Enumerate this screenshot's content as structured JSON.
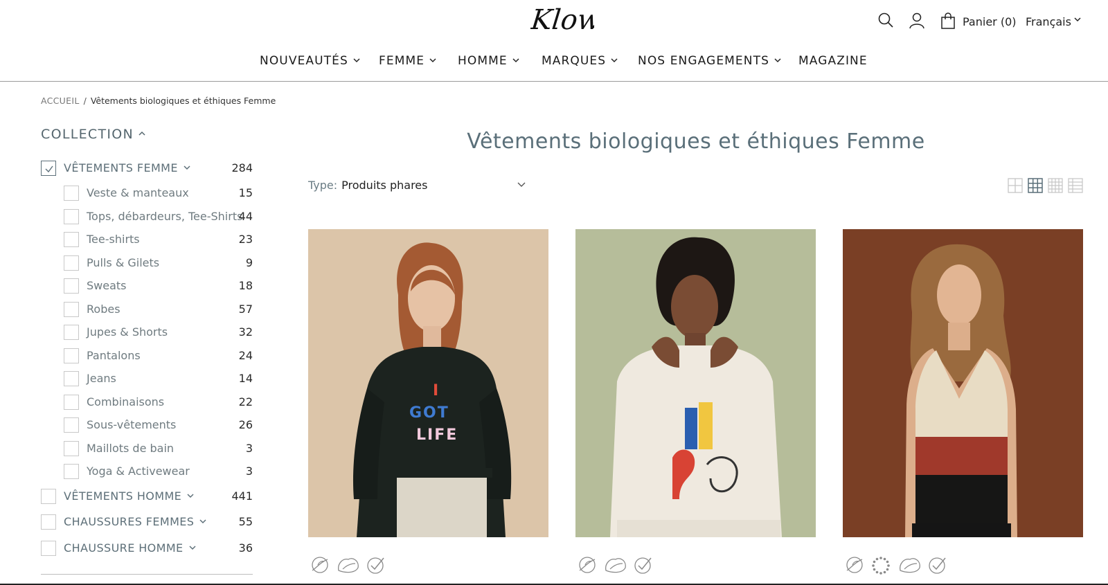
{
  "header": {
    "logo_text": "Klow",
    "cart_label": "Panier (0)",
    "language": "Français",
    "icons": [
      "search-icon",
      "account-icon",
      "cart-icon"
    ]
  },
  "nav": {
    "items": [
      {
        "label": "NOUVEAUTÉS",
        "has_dropdown": true
      },
      {
        "label": "FEMME",
        "has_dropdown": true
      },
      {
        "label": "HOMME",
        "has_dropdown": true
      },
      {
        "label": "MARQUES",
        "has_dropdown": true
      },
      {
        "label": "NOS ENGAGEMENTS",
        "has_dropdown": true
      },
      {
        "label": "MAGAZINE",
        "has_dropdown": false
      }
    ]
  },
  "breadcrumb": {
    "home": "ACCUEIL",
    "separator": "/",
    "current": "Vêtements biologiques et éthiques Femme"
  },
  "sidebar": {
    "title": "COLLECTION",
    "categories": [
      {
        "label": "VÊTEMENTS FEMME",
        "count": "284",
        "checked": true,
        "expanded": true,
        "children": [
          {
            "label": "Veste & manteaux",
            "count": "15"
          },
          {
            "label": "Tops, débardeurs, Tee-Shirts",
            "count": "44"
          },
          {
            "label": "Tee-shirts",
            "count": "23"
          },
          {
            "label": "Pulls & Gilets",
            "count": "9"
          },
          {
            "label": "Sweats",
            "count": "18"
          },
          {
            "label": "Robes",
            "count": "57"
          },
          {
            "label": "Jupes & Shorts",
            "count": "32"
          },
          {
            "label": "Pantalons",
            "count": "24"
          },
          {
            "label": "Jeans",
            "count": "14"
          },
          {
            "label": "Combinaisons",
            "count": "22"
          },
          {
            "label": "Sous-vêtements",
            "count": "26"
          },
          {
            "label": "Maillots de bain",
            "count": "3"
          },
          {
            "label": "Yoga & Activewear",
            "count": "3"
          }
        ]
      },
      {
        "label": "VÊTEMENTS HOMME",
        "count": "441",
        "checked": false
      },
      {
        "label": "CHAUSSURES FEMMES",
        "count": "55",
        "checked": false
      },
      {
        "label": "CHAUSSURE HOMME",
        "count": "36",
        "checked": false
      }
    ]
  },
  "main": {
    "title": "Vêtements biologiques et éthiques Femme",
    "sort_label": "Type:",
    "sort_value": "Produits phares",
    "view_modes": [
      "grid-2-icon",
      "grid-3-icon",
      "grid-4-icon",
      "list-icon"
    ],
    "active_view": 1,
    "products": [
      {
        "image": "woman-black-sweatshirt-image",
        "shirt_text_1": "I",
        "shirt_text_2": "GOT",
        "shirt_text_3": "LIFE",
        "bg": "#dcc5a9",
        "badges": [
          "vegan-icon",
          "organic-leaf-icon",
          "certified-icon"
        ]
      },
      {
        "image": "woman-cream-sweatshirt-image",
        "bg": "#b6bd9a",
        "badges": [
          "vegan-icon",
          "organic-leaf-icon",
          "certified-icon"
        ]
      },
      {
        "image": "woman-knit-tank-image",
        "bg": "#7a3f25",
        "badges": [
          "vegan-icon",
          "eu-label-icon",
          "organic-leaf-icon",
          "certified-icon"
        ]
      }
    ]
  },
  "colors": {
    "accent_grey_blue": "#5a6f79",
    "text_dark": "#1a1a1a",
    "muted": "#6f7b80"
  }
}
